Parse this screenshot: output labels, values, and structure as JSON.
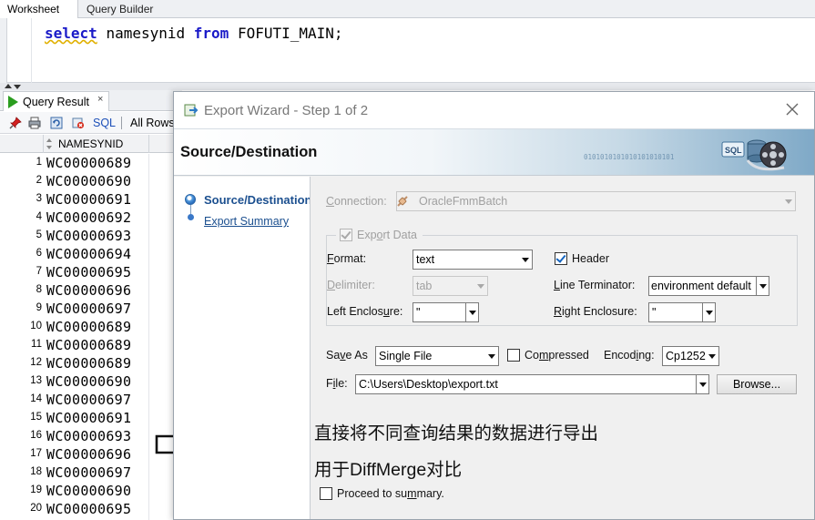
{
  "worksheet_tabs": [
    "Worksheet",
    "Query Builder"
  ],
  "editor": {
    "kw_select": "select",
    "column": "namesynid",
    "kw_from": "from",
    "table": "FOFUTI_MAIN;"
  },
  "query_result": {
    "tab_label": "Query Result",
    "tab_close": "×",
    "sql_link": "SQL",
    "rows_info": "All Rows",
    "column_header": "NAMESYNID",
    "rows": [
      {
        "n": "1",
        "v": "WC00000689"
      },
      {
        "n": "2",
        "v": "WC00000690"
      },
      {
        "n": "3",
        "v": "WC00000691"
      },
      {
        "n": "4",
        "v": "WC00000692"
      },
      {
        "n": "5",
        "v": "WC00000693"
      },
      {
        "n": "6",
        "v": "WC00000694"
      },
      {
        "n": "7",
        "v": "WC00000695"
      },
      {
        "n": "8",
        "v": "WC00000696"
      },
      {
        "n": "9",
        "v": "WC00000697"
      },
      {
        "n": "10",
        "v": "WC00000689"
      },
      {
        "n": "11",
        "v": "WC00000689"
      },
      {
        "n": "12",
        "v": "WC00000689"
      },
      {
        "n": "13",
        "v": "WC00000690"
      },
      {
        "n": "14",
        "v": "WC00000697"
      },
      {
        "n": "15",
        "v": "WC00000691"
      },
      {
        "n": "16",
        "v": "WC00000693"
      },
      {
        "n": "17",
        "v": "WC00000696"
      },
      {
        "n": "18",
        "v": "WC00000697"
      },
      {
        "n": "19",
        "v": "WC00000690"
      },
      {
        "n": "20",
        "v": "WC00000695"
      }
    ]
  },
  "wizard": {
    "title": "Export Wizard - Step 1 of 2",
    "heading": "Source/Destination",
    "banner_binary": "0101010101010101010101",
    "steps": [
      "Source/Destination",
      "Export Summary"
    ],
    "connection_label_a": "C",
    "connection_label_b": "onnection:",
    "connection_value": "OracleFmmBatch",
    "export_data_label_a": "Exp",
    "export_data_label_b": "o",
    "export_data_label_c": "rt Data",
    "export_data_checked": true,
    "format_label_a": "F",
    "format_label_b": "ormat:",
    "format_value": "text",
    "header_label": "Header",
    "header_checked": true,
    "delimiter_label_a": "D",
    "delimiter_label_b": "elimiter:",
    "delimiter_value": "tab",
    "line_term_label_a": "L",
    "line_term_label_b": "ine Terminator:",
    "line_term_value": "environment default",
    "left_encl_label_a": "Left Enclos",
    "left_encl_label_b": "u",
    "left_encl_label_c": "re:",
    "left_encl_value": "\"",
    "right_encl_label_a": "R",
    "right_encl_label_b": "ight Enclosure:",
    "right_encl_value": "\"",
    "save_as_label_a": "Sa",
    "save_as_label_b": "v",
    "save_as_label_c": "e As",
    "save_as_value": "Single File",
    "compressed_label_a": "Co",
    "compressed_label_b": "m",
    "compressed_label_c": "pressed",
    "compressed_checked": false,
    "encoding_label_a": "Encod",
    "encoding_label_b": "i",
    "encoding_label_c": "ng:",
    "encoding_value": "Cp1252",
    "file_label_a": "F",
    "file_label_b": "i",
    "file_label_c": "le:",
    "file_value": "C:\\Users\\Desktop\\export.txt",
    "browse_button": "Browse...",
    "proceed_label_a": "Proceed to su",
    "proceed_label_b": "m",
    "proceed_label_c": "mary.",
    "proceed_checked": false
  },
  "annotations": {
    "line1": "直接将不同查询结果的数据进行导出",
    "line2": "用于DiffMerge对比"
  },
  "colors": {
    "keyword": "#1a1ac8",
    "link": "#1c4fb8",
    "play_icon": "#2a9d1f"
  }
}
